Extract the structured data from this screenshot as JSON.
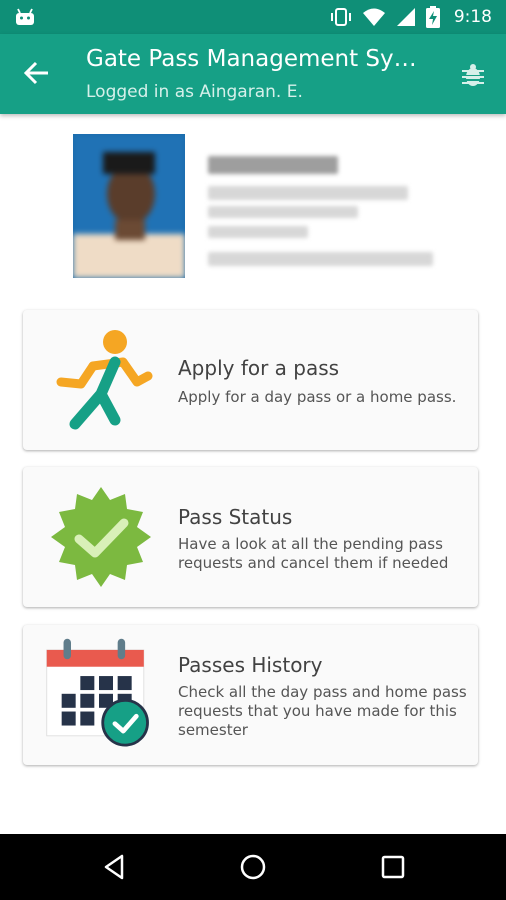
{
  "status_bar": {
    "time": "9:18",
    "icons": [
      "android-icon",
      "vibrate-icon",
      "wifi-icon",
      "signal-icon",
      "battery-charging-icon"
    ]
  },
  "app_bar": {
    "title": "Gate Pass Management System",
    "subtitle": "Logged in as Aingaran. E.",
    "back_icon": "arrow-left-icon",
    "action_icon": "bug-icon"
  },
  "cards": [
    {
      "title": "Apply for a pass",
      "description": "Apply for a day pass or a home pass.",
      "icon": "running-person-icon"
    },
    {
      "title": "Pass Status",
      "description": "Have a look at all the pending pass requests and cancel them if needed",
      "icon": "verified-badge-icon"
    },
    {
      "title": "Passes History",
      "description": "Check all the day pass and home pass requests that you have made for this semester",
      "icon": "calendar-check-icon"
    }
  ],
  "colors": {
    "primary": "#16a086",
    "primary_dark": "#0f8f77",
    "badge_green": "#7cb940",
    "runner_orange": "#f5a623",
    "runner_teal": "#16a086",
    "calendar_red": "#e95a4e"
  },
  "nav_bar": {
    "icons": [
      "back-triangle-icon",
      "home-circle-icon",
      "recents-square-icon"
    ]
  }
}
